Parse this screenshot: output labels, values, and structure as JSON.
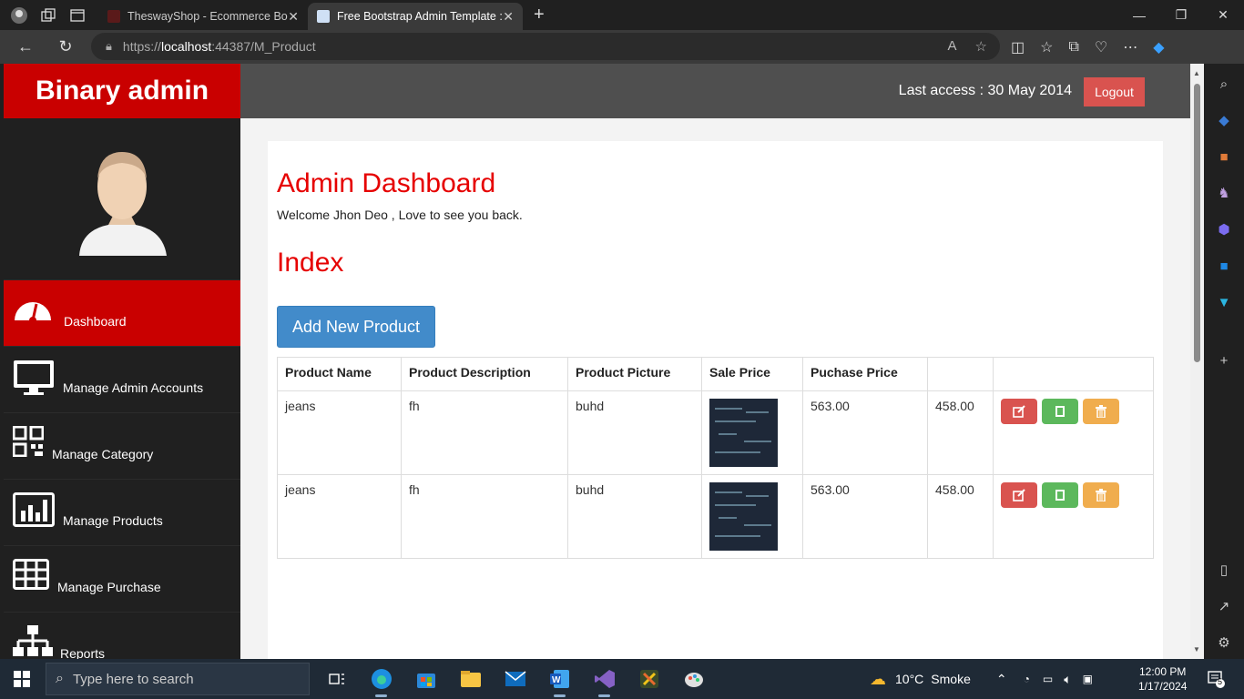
{
  "browser": {
    "tabs": [
      {
        "title": "TheswayShop - Ecommerce Bootst",
        "active": false
      },
      {
        "title": "Free Bootstrap Admin Template :",
        "active": true
      }
    ],
    "url": {
      "prefix": "https://",
      "host": "localhost",
      "rest": ":44387/M_Product"
    }
  },
  "app": {
    "brand": "Binary admin",
    "last_access": "Last access : 30 May 2014",
    "logout_label": "Logout"
  },
  "sidebar": {
    "items": [
      {
        "label": "Dashboard",
        "icon": "dashboard-icon",
        "active": true
      },
      {
        "label": "Manage Admin Accounts",
        "icon": "desktop-icon"
      },
      {
        "label": "Manage Category",
        "icon": "qrcode-icon"
      },
      {
        "label": "Manage Products",
        "icon": "bar-chart-icon"
      },
      {
        "label": "Manage Purchase",
        "icon": "table-icon"
      },
      {
        "label": "Reports",
        "icon": "sitemap-icon"
      }
    ]
  },
  "main": {
    "title": "Admin Dashboard",
    "welcome": "Welcome Jhon Deo , Love to see you back.",
    "subtitle": "Index",
    "add_button": "Add New Product",
    "table": {
      "headers": [
        "Product Name",
        "Product Description",
        "Product Picture",
        "Sale Price",
        "Puchase Price",
        "",
        ""
      ],
      "rows": [
        {
          "name": "jeans",
          "description": "fh",
          "picture": "buhd",
          "sale": "563.00",
          "purchase": "458.00"
        },
        {
          "name": "jeans",
          "description": "fh",
          "picture": "buhd",
          "sale": "563.00",
          "purchase": "458.00"
        }
      ]
    }
  },
  "taskbar": {
    "search_placeholder": "Type here to search",
    "weather_temp": "10°C",
    "weather_desc": "Smoke",
    "time": "12:00 PM",
    "date": "1/17/2024",
    "notifications": "5"
  },
  "colors": {
    "brand_red": "#c90000",
    "title_red": "#e60000",
    "primary": "#428bca"
  }
}
